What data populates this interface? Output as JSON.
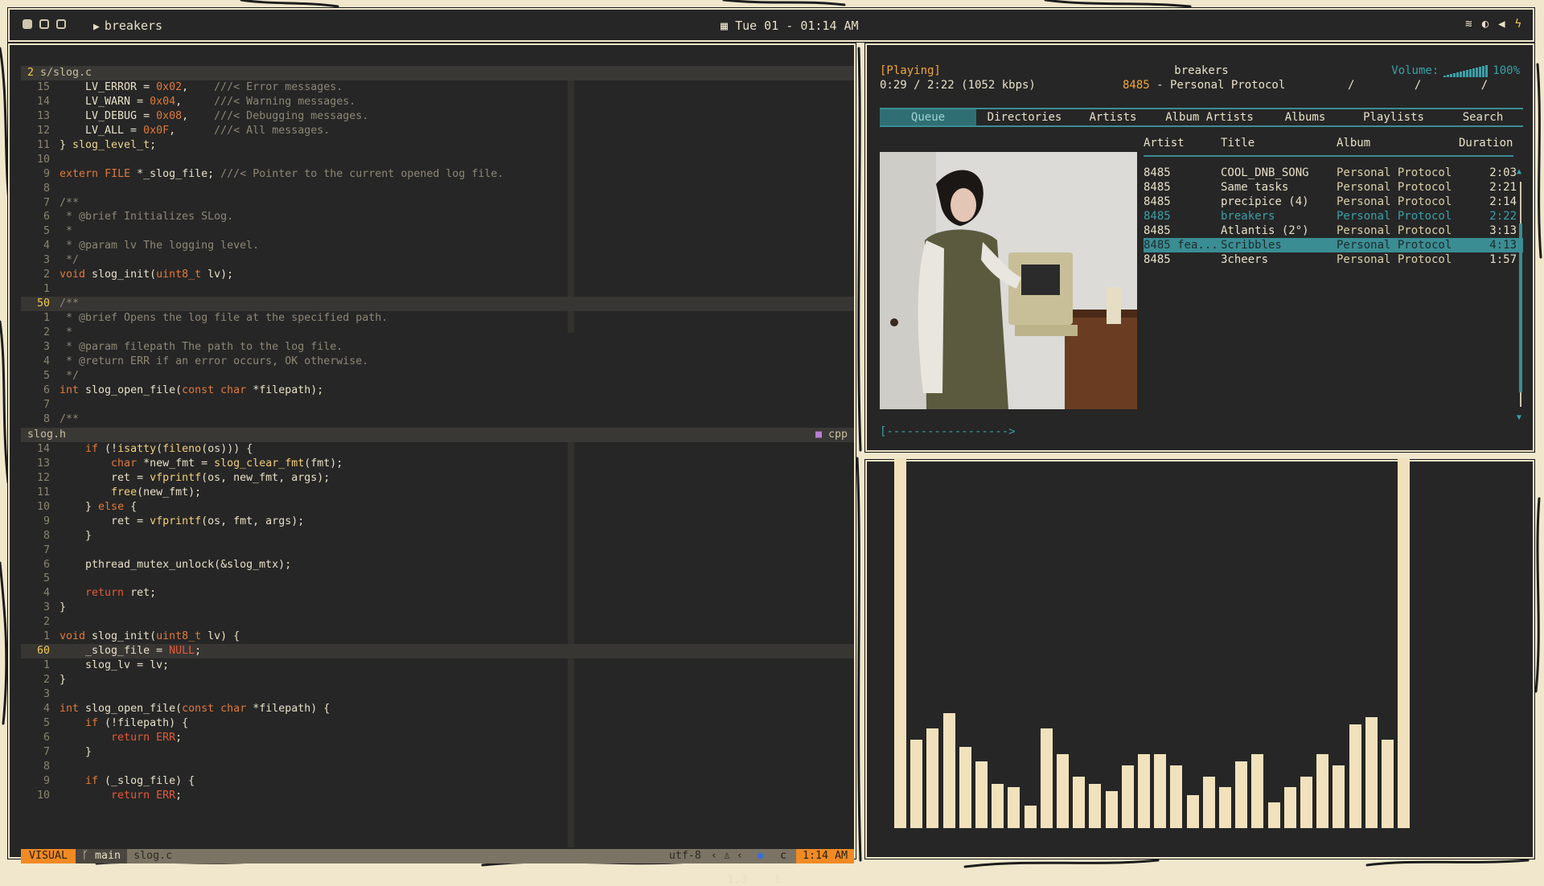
{
  "topbar": {
    "workspace": "breakers",
    "date_icon": "calendar-icon",
    "datetime": "Tue 01 - 01:14 AM",
    "tray_icons": [
      "wifi-icon",
      "brightness-icon",
      "volume-icon",
      "battery-bolt-icon"
    ]
  },
  "editor": {
    "top_buffer": {
      "winbar_num": "2",
      "winbar_path": " s/slog.c",
      "lines": [
        {
          "n": "15",
          "html": "    LV_ERROR = 0x02,    ///< Error messages."
        },
        {
          "n": "14",
          "html": "    LV_WARN = 0x04,     ///< Warning messages."
        },
        {
          "n": "13",
          "html": "    LV_DEBUG = 0x08,    ///< Debugging messages."
        },
        {
          "n": "12",
          "html": "    LV_ALL = 0x0F,      ///< All messages."
        },
        {
          "n": "11",
          "html": "} slog_level_t;"
        },
        {
          "n": "10",
          "html": ""
        },
        {
          "n": "9",
          "html": "extern FILE *_slog_file; ///< Pointer to the current opened log file."
        },
        {
          "n": "8",
          "html": ""
        },
        {
          "n": "7",
          "html": "/**"
        },
        {
          "n": "6",
          "html": " * @brief Initializes SLog."
        },
        {
          "n": "5",
          "html": " *"
        },
        {
          "n": "4",
          "html": " * @param lv The logging level."
        },
        {
          "n": "3",
          "html": " */"
        },
        {
          "n": "2",
          "html": "void slog_init(uint8_t lv);"
        },
        {
          "n": "1",
          "html": ""
        },
        {
          "n": "50",
          "html": "/**",
          "current": true
        },
        {
          "n": "1",
          "html": " * @brief Opens the log file at the specified path."
        },
        {
          "n": "2",
          "html": " *"
        },
        {
          "n": "3",
          "html": " * @param filepath The path to the log file."
        },
        {
          "n": "4",
          "html": " * @return ERR if an error occurs, OK otherwise."
        },
        {
          "n": "5",
          "html": " */"
        },
        {
          "n": "6",
          "html": "int slog_open_file(const char *filepath);"
        },
        {
          "n": "7",
          "html": ""
        },
        {
          "n": "8",
          "html": "/**"
        }
      ]
    },
    "mid_winbar": {
      "name": "slog.h",
      "lang": "cpp"
    },
    "bottom_buffer": {
      "lines": [
        {
          "n": "14",
          "html": "    if (!isatty(fileno(os))) {"
        },
        {
          "n": "13",
          "html": "        char *new_fmt = slog_clear_fmt(fmt);"
        },
        {
          "n": "12",
          "html": "        ret = vfprintf(os, new_fmt, args);"
        },
        {
          "n": "11",
          "html": "        free(new_fmt);"
        },
        {
          "n": "10",
          "html": "    } else {"
        },
        {
          "n": "9",
          "html": "        ret = vfprintf(os, fmt, args);"
        },
        {
          "n": "8",
          "html": "    }"
        },
        {
          "n": "7",
          "html": ""
        },
        {
          "n": "6",
          "html": "    pthread_mutex_unlock(&slog_mtx);"
        },
        {
          "n": "5",
          "html": ""
        },
        {
          "n": "4",
          "html": "    return ret;"
        },
        {
          "n": "3",
          "html": "}"
        },
        {
          "n": "2",
          "html": ""
        },
        {
          "n": "1",
          "html": "void slog_init(uint8_t lv) {"
        },
        {
          "n": "60",
          "html": "    _slog_file = NULL;",
          "current": true
        },
        {
          "n": "1",
          "html": "    slog_lv = lv;"
        },
        {
          "n": "2",
          "html": "}"
        },
        {
          "n": "3",
          "html": ""
        },
        {
          "n": "4",
          "html": "int slog_open_file(const char *filepath) {"
        },
        {
          "n": "5",
          "html": "    if (!filepath) {"
        },
        {
          "n": "6",
          "html": "        return ERR;"
        },
        {
          "n": "7",
          "html": "    }"
        },
        {
          "n": "8",
          "html": ""
        },
        {
          "n": "9",
          "html": "    if (_slog_file) {"
        },
        {
          "n": "10",
          "html": "        return ERR;"
        }
      ]
    },
    "statusline": {
      "mode": "VISUAL",
      "branch": " main",
      "file": "slog.c",
      "encoding": "utf-8",
      "filetype": "c",
      "time": "1:14 AM"
    },
    "cmdline": {
      "pos": "1,3",
      "count": "1"
    }
  },
  "player": {
    "state": "[Playing]",
    "time": "0:29 / 2:22 (1052 kbps)",
    "title": "breakers",
    "artist": "8485",
    "album_sep": " - Personal Protocol",
    "slashes": "/ / /",
    "volume_label": "Volume:",
    "volume_pct": "100%",
    "tabs": [
      "Queue",
      "Directories",
      "Artists",
      "Album Artists",
      "Albums",
      "Playlists",
      "Search"
    ],
    "active_tab": "Queue",
    "columns": [
      "Artist",
      "Title",
      "Album",
      "Duration"
    ],
    "queue": [
      {
        "artist": "8485",
        "title": "COOL_DNB_SONG",
        "album": "Personal Protocol",
        "duration": "2:03"
      },
      {
        "artist": "8485",
        "title": "Same tasks",
        "album": "Personal Protocol",
        "duration": "2:21"
      },
      {
        "artist": "8485",
        "title": "precipice (4)",
        "album": "Personal Protocol",
        "duration": "2:14"
      },
      {
        "artist": "8485",
        "title": "breakers",
        "album": "Personal Protocol",
        "duration": "2:22",
        "playing": true
      },
      {
        "artist": "8485",
        "title": "Atlantis (2°)",
        "album": "Personal Protocol",
        "duration": "3:13"
      },
      {
        "artist": "8485 fea...",
        "title": "Scribbles",
        "album": "Personal Protocol",
        "duration": "4:13",
        "selected": true
      },
      {
        "artist": "8485",
        "title": "3cheers",
        "album": "Personal Protocol",
        "duration": "1:57"
      }
    ],
    "progress": "[------------------>"
  },
  "visualizer": {
    "levels": [
      1.0,
      0.24,
      0.27,
      0.31,
      0.22,
      0.18,
      0.12,
      0.11,
      0.06,
      0.27,
      0.2,
      0.14,
      0.12,
      0.1,
      0.17,
      0.2,
      0.2,
      0.17,
      0.09,
      0.14,
      0.11,
      0.18,
      0.2,
      0.07,
      0.11,
      0.14,
      0.2,
      0.17,
      0.28,
      0.3,
      0.24,
      1.0
    ]
  },
  "colors": {
    "accent": "#3a8d93",
    "mode_orange": "#f08a24",
    "line_number_current": "#f2c84b"
  }
}
